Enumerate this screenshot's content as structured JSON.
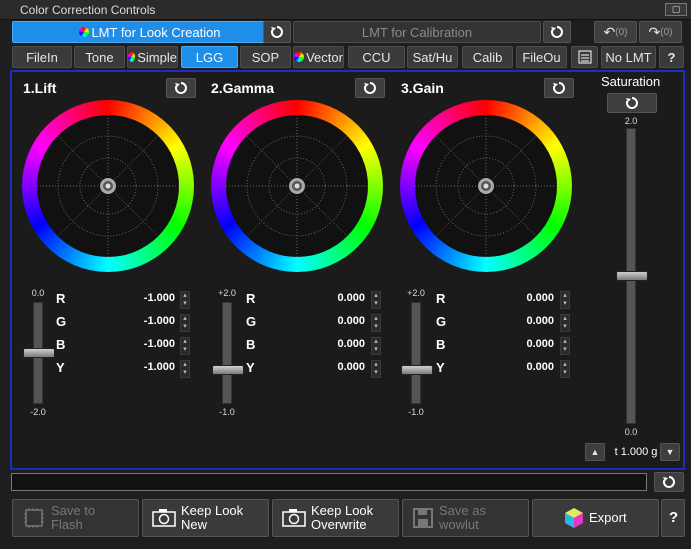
{
  "window": {
    "title": "Color Correction Controls"
  },
  "mode_tabs": {
    "lmt_look": "LMT for Look Creation",
    "lmt_calibration": "LMT for Calibration",
    "undo_count": "(0)",
    "redo_count": "(0)"
  },
  "tabs": [
    {
      "label": "FileIn"
    },
    {
      "label": "Tone"
    },
    {
      "label": "Simple"
    },
    {
      "label": "LGG"
    },
    {
      "label": "SOP"
    },
    {
      "label": "Vector"
    },
    {
      "label": "CCU"
    },
    {
      "label": "Sat/Hu"
    },
    {
      "label": "Calib"
    },
    {
      "label": "FileOu"
    }
  ],
  "no_lmt": "No LMT",
  "help": "?",
  "sections": [
    {
      "title": "1.Lift",
      "slider_max": "0.0",
      "slider_min": "-2.0",
      "level": 0.5,
      "channels": [
        {
          "name": "R",
          "value": "-1.000"
        },
        {
          "name": "G",
          "value": "-1.000"
        },
        {
          "name": "B",
          "value": "-1.000"
        },
        {
          "name": "Y",
          "value": "-1.000"
        }
      ]
    },
    {
      "title": "2.Gamma",
      "slider_max": "+2.0",
      "slider_min": "-1.0",
      "level": 0.333,
      "channels": [
        {
          "name": "R",
          "value": "0.000"
        },
        {
          "name": "G",
          "value": "0.000"
        },
        {
          "name": "B",
          "value": "0.000"
        },
        {
          "name": "Y",
          "value": "0.000"
        }
      ]
    },
    {
      "title": "3.Gain",
      "slider_max": "+2.0",
      "slider_min": "-1.0",
      "level": 0.333,
      "channels": [
        {
          "name": "R",
          "value": "0.000"
        },
        {
          "name": "G",
          "value": "0.000"
        },
        {
          "name": "B",
          "value": "0.000"
        },
        {
          "name": "Y",
          "value": "0.000"
        }
      ]
    }
  ],
  "saturation": {
    "label": "Saturation",
    "max": "2.0",
    "min": "0.0",
    "level": 0.5,
    "value": "1.000",
    "prefix": "t",
    "suffix": "g"
  },
  "bottom": {
    "save_flash": [
      "Save to",
      "Flash"
    ],
    "keep_new": [
      "Keep Look",
      "New"
    ],
    "keep_overwrite": [
      "Keep Look",
      "Overwrite"
    ],
    "save_wowlut": [
      "Save as",
      "wowlut"
    ],
    "export": "Export",
    "help": "?"
  }
}
